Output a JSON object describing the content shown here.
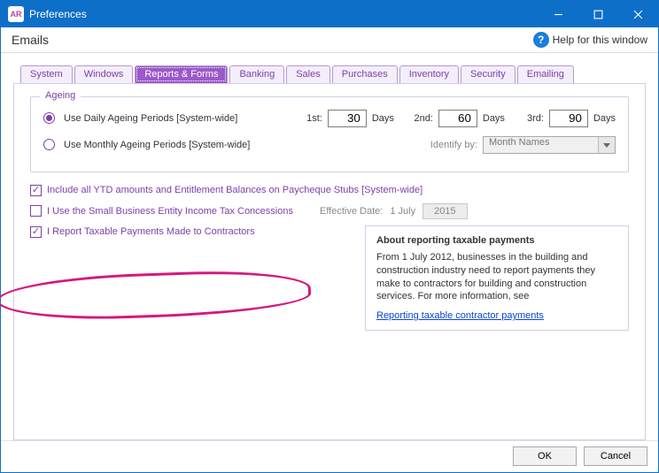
{
  "titlebar": {
    "app_icon_text": "AR",
    "title": "Preferences"
  },
  "subheader": {
    "title": "Emails",
    "help_text": "Help for this window"
  },
  "tabs": [
    "System",
    "Windows",
    "Reports & Forms",
    "Banking",
    "Sales",
    "Purchases",
    "Inventory",
    "Security",
    "Emailing"
  ],
  "ageing": {
    "legend": "Ageing",
    "daily_label": "Use Daily Ageing Periods [System-wide]",
    "monthly_label": "Use Monthly Ageing Periods [System-wide]",
    "first_label": "1st:",
    "second_label": "2nd:",
    "third_label": "3rd:",
    "days_suffix": "Days",
    "first_value": "30",
    "second_value": "60",
    "third_value": "90",
    "identify_label": "Identify by:",
    "identify_value": "Month Names"
  },
  "checks": {
    "ytd_label": "Include all YTD amounts and Entitlement Balances on Paycheque Stubs [System-wide]",
    "sbe_label": "I Use the Small Business Entity Income Tax Concessions",
    "tpar_label": "I Report Taxable Payments Made to Contractors",
    "effective_label": "Effective Date:",
    "effective_day": "1 July",
    "effective_year": "2015"
  },
  "about": {
    "title": "About reporting taxable payments",
    "body": "From 1 July 2012, businesses in the building and construction industry need to report payments they make to contractors for building and construction services. For more information, see",
    "link": "Reporting taxable contractor payments"
  },
  "footer": {
    "ok": "OK",
    "cancel": "Cancel"
  }
}
